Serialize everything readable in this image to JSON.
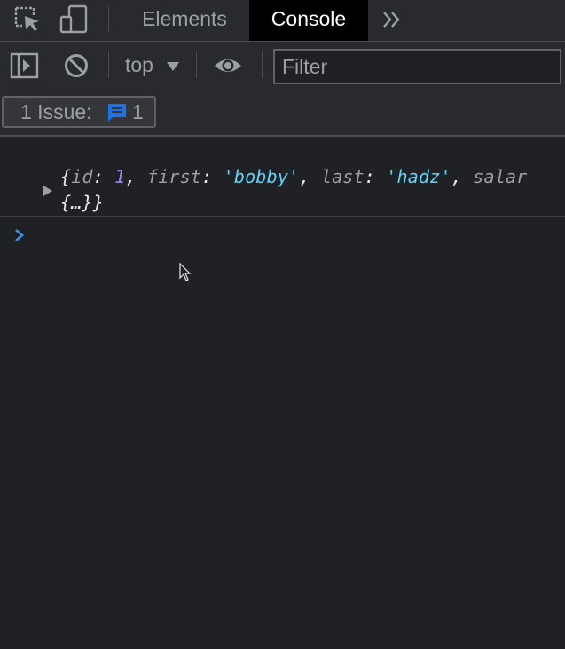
{
  "tabs": {
    "elements_label": "Elements",
    "console_label": "Console"
  },
  "toolbar": {
    "context": "top",
    "filter_placeholder": "Filter"
  },
  "issues": {
    "label": "1 Issue:",
    "count": "1"
  },
  "console": {
    "log_line1": [
      {
        "t": "{",
        "c": "p"
      },
      {
        "t": "id",
        "c": "k"
      },
      {
        "t": ": ",
        "c": "p"
      },
      {
        "t": "1",
        "c": "n"
      },
      {
        "t": ", ",
        "c": "p"
      },
      {
        "t": "first",
        "c": "k"
      },
      {
        "t": ": ",
        "c": "p"
      },
      {
        "t": "'bobby'",
        "c": "s"
      },
      {
        "t": ", ",
        "c": "p"
      },
      {
        "t": "last",
        "c": "k"
      },
      {
        "t": ": ",
        "c": "p"
      },
      {
        "t": "'hadz'",
        "c": "s"
      },
      {
        "t": ", ",
        "c": "p"
      },
      {
        "t": "salar",
        "c": "k"
      }
    ],
    "log_line2": "{…}}"
  },
  "colors": {
    "accent_blue": "#1a73e8",
    "prompt_blue": "#3f8ee6",
    "string_cyan": "#5cd5fb",
    "number_purple": "#9980ff"
  },
  "icons": [
    "inspect-element-icon",
    "device-toggle-icon",
    "more-tabs-icon",
    "sidebar-toggle-icon",
    "clear-console-icon",
    "dropdown-arrow-icon",
    "live-expression-eye-icon",
    "issue-message-icon",
    "expand-arrow-icon",
    "prompt-chevron-icon",
    "mouse-cursor-icon"
  ]
}
